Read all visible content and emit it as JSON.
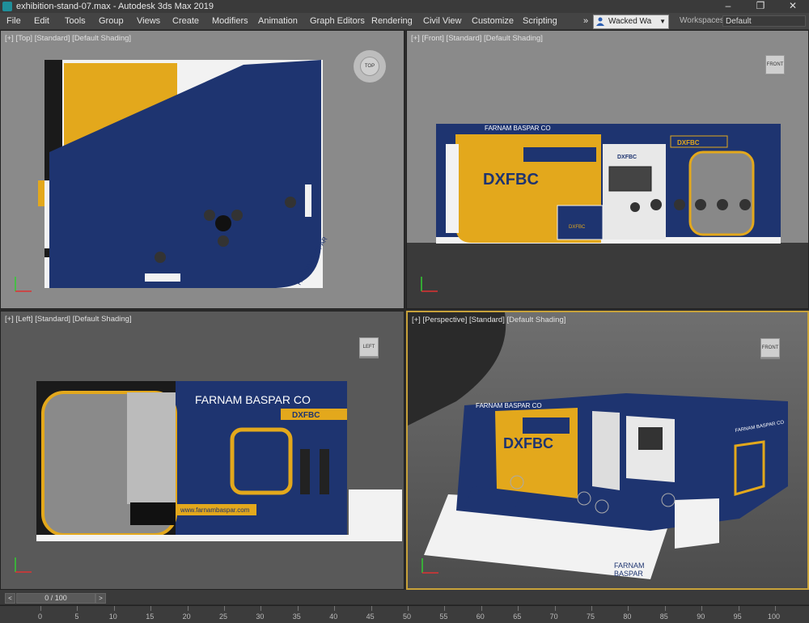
{
  "window": {
    "title": "exhibition-stand-07.max - Autodesk 3ds Max 2019",
    "min": "–",
    "max": "❐",
    "close": "✕"
  },
  "menu": [
    "File",
    "Edit",
    "Tools",
    "Group",
    "Views",
    "Create",
    "Modifiers",
    "Animation",
    "Graph Editors",
    "Rendering",
    "Civil View",
    "Customize",
    "Scripting"
  ],
  "menu_overflow": "»",
  "user": {
    "name": "Wacked Wa"
  },
  "workspaces": {
    "label": "Workspaces:",
    "value": "Default"
  },
  "viewports": {
    "top": {
      "label": "[+] [Top] [Standard] [Default Shading]",
      "cube": "TOP"
    },
    "front": {
      "label": "[+] [Front] [Standard] [Default Shading]",
      "cube": "FRONT"
    },
    "left": {
      "label": "[+] [Left] [Standard] [Default Shading]",
      "cube": "LEFT"
    },
    "perspective": {
      "label": "[+] [Perspective] [Standard] [Default Shading]",
      "cube": "FRONT"
    }
  },
  "stand": {
    "company": "FARNAM BASPAR CO",
    "logo": "DXFBC",
    "website": "www.farnambaspar.com",
    "sign_line1": "FARNAM",
    "sign_line2": "BASPAR",
    "top_floor_text": "FARNAM BASPAR",
    "persp_side": "FARNAM BASPAR CO",
    "colors": {
      "navy": "#1e3470",
      "gold": "#e3a81c",
      "white": "#f2f2f2",
      "floor": "#2a2a2a"
    }
  },
  "timeline": {
    "frame": "0 / 100",
    "prev": "<",
    "next": ">",
    "ticks": [
      "0",
      "5",
      "10",
      "15",
      "20",
      "25",
      "30",
      "35",
      "40",
      "45",
      "50",
      "55",
      "60",
      "65",
      "70",
      "75",
      "80",
      "85",
      "90",
      "95",
      "100"
    ]
  }
}
